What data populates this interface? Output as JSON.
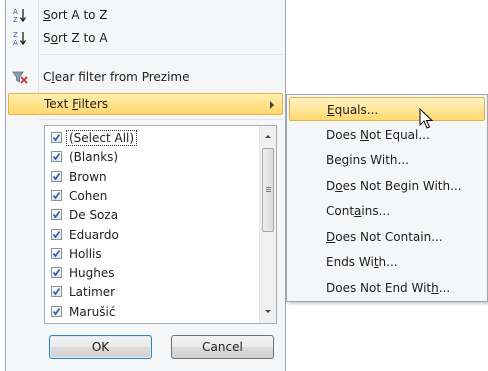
{
  "menu": {
    "sort_az": {
      "pre": "",
      "u": "S",
      "post": "ort A to Z",
      "icon": "sort-ascending-icon"
    },
    "sort_za": {
      "pre": "S",
      "u": "o",
      "post": "rt Z to A",
      "icon": "sort-descending-icon"
    },
    "clear_filter": {
      "pre": "C",
      "u": "l",
      "post": "ear filter from Prezime",
      "icon": "clear-filter-icon"
    },
    "text_filters": {
      "pre": "Text ",
      "u": "F",
      "post": "ilters"
    }
  },
  "list": {
    "items": [
      {
        "label": "(Select All)",
        "checked": true
      },
      {
        "label": "(Blanks)",
        "checked": true
      },
      {
        "label": "Brown",
        "checked": true
      },
      {
        "label": "Cohen",
        "checked": true
      },
      {
        "label": "De Soza",
        "checked": true
      },
      {
        "label": "Eduardo",
        "checked": true
      },
      {
        "label": "Hollis",
        "checked": true
      },
      {
        "label": "Hughes",
        "checked": true
      },
      {
        "label": "Latimer",
        "checked": true
      },
      {
        "label": "Marušić",
        "checked": true
      }
    ]
  },
  "buttons": {
    "ok": "OK",
    "cancel": "Cancel"
  },
  "submenu": {
    "items": [
      {
        "pre": "",
        "u": "E",
        "post": "quals..."
      },
      {
        "pre": "Does ",
        "u": "N",
        "post": "ot Equal..."
      },
      {
        "pre": "Be",
        "u": "g",
        "post": "ins With..."
      },
      {
        "pre": "D",
        "u": "o",
        "post": "es Not Begin With..."
      },
      {
        "pre": "Cont",
        "u": "a",
        "post": "ins..."
      },
      {
        "pre": "",
        "u": "D",
        "post": "oes Not Contain..."
      },
      {
        "pre": "Ends Wi",
        "u": "t",
        "post": "h..."
      },
      {
        "pre": "Does Not End Wit",
        "u": "h",
        "post": "..."
      }
    ]
  },
  "colors": {
    "highlight": "#ffd86c",
    "check": "#2a58a8",
    "clear_icon_red": "#d03030"
  }
}
